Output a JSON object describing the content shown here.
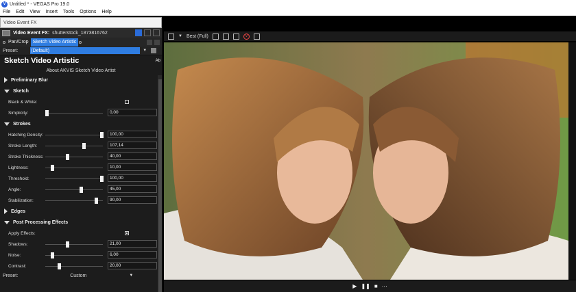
{
  "window": {
    "title": "Untitled * - VEGAS Pro 19.0",
    "logo_letter": "V"
  },
  "menu": [
    "File",
    "Edit",
    "View",
    "Insert",
    "Tools",
    "Options",
    "Help"
  ],
  "fx_panel": {
    "window_title": "Video Event FX",
    "header_label": "Video Event FX:",
    "header_clip": "shutterstock_1873816762",
    "chain": [
      "Pan/Crop",
      "Sketch Video Artistic"
    ],
    "preset_label": "Preset:",
    "preset_value": "(Default)"
  },
  "plugin": {
    "title": "Sketch Video Artistic",
    "about_short": "Ab",
    "about_link": "About AKVIS Sketch Video  Artist"
  },
  "sections": {
    "preliminary_blur": "Preliminary Blur",
    "sketch": "Sketch",
    "strokes": "Strokes",
    "edges": "Edges",
    "post_processing": "Post Processing Effects"
  },
  "params": {
    "black_white": {
      "label": "Black & White:",
      "checked": false
    },
    "simplicity": {
      "label": "Simplicity:",
      "value": "0,00",
      "level": 0.0
    },
    "hatching_density": {
      "label": "Hatching Density:",
      "value": "100,00",
      "level": 1.0
    },
    "stroke_length": {
      "label": "Stroke Length:",
      "value": "107,14",
      "level": 0.68
    },
    "stroke_thickness": {
      "label": "Stroke Thickness:",
      "value": "40,00",
      "level": 0.37
    },
    "lightness": {
      "label": "Lightness:",
      "value": "10,00",
      "level": 0.1
    },
    "threshold": {
      "label": "Threshold:",
      "value": "100,00",
      "level": 1.0
    },
    "angle": {
      "label": "Angle:",
      "value": "45,00",
      "level": 0.62
    },
    "stabilization": {
      "label": "Stabilization:",
      "value": "90,00",
      "level": 0.9
    },
    "apply_effects": {
      "label": "Apply Effects:",
      "checked": true
    },
    "shadows": {
      "label": "Shadows:",
      "value": "21,00",
      "level": 0.38
    },
    "noise": {
      "label": "Noise:",
      "value": "6,00",
      "level": 0.1
    },
    "contrast": {
      "label": "Contrast:",
      "value": "20,00",
      "level": 0.22
    }
  },
  "bottom_preset": {
    "label": "Preset:",
    "value": "Custom"
  },
  "preview": {
    "quality": "Best (Full)"
  },
  "colors": {
    "accent": "#2f7de1",
    "panel_bg": "#1c1c1c"
  }
}
